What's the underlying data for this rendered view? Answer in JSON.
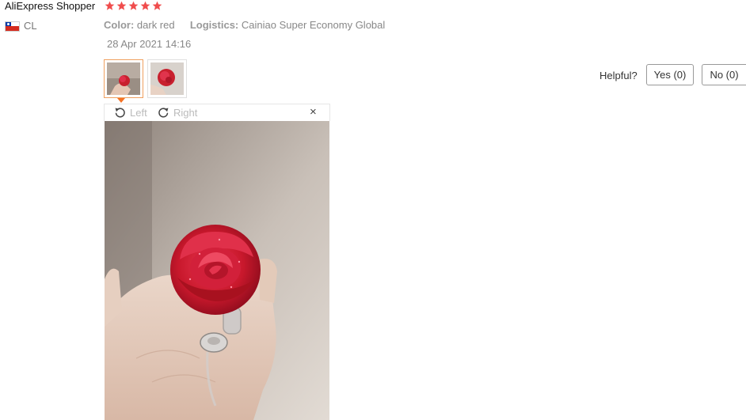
{
  "review": {
    "user_name": "AliExpress Shopper",
    "rating": 5,
    "star_color": "#f04d4d",
    "country_code": "CL",
    "attributes": [
      {
        "key": "Color:",
        "value": "dark red"
      },
      {
        "key": "Logistics:",
        "value": "Cainiao Super Economy Global"
      }
    ],
    "date": "28 Apr 2021 14:16",
    "thumbnails": [
      {
        "alt": "photo-1",
        "active": true
      },
      {
        "alt": "photo-2",
        "active": false
      }
    ]
  },
  "helpful": {
    "label": "Helpful?",
    "yes": "Yes (0)",
    "no": "No (0)"
  },
  "viewer": {
    "rotate_left": "Left",
    "rotate_right": "Right",
    "close": "×"
  },
  "colors": {
    "accent": "#f57224",
    "flower": "#d8203a"
  }
}
